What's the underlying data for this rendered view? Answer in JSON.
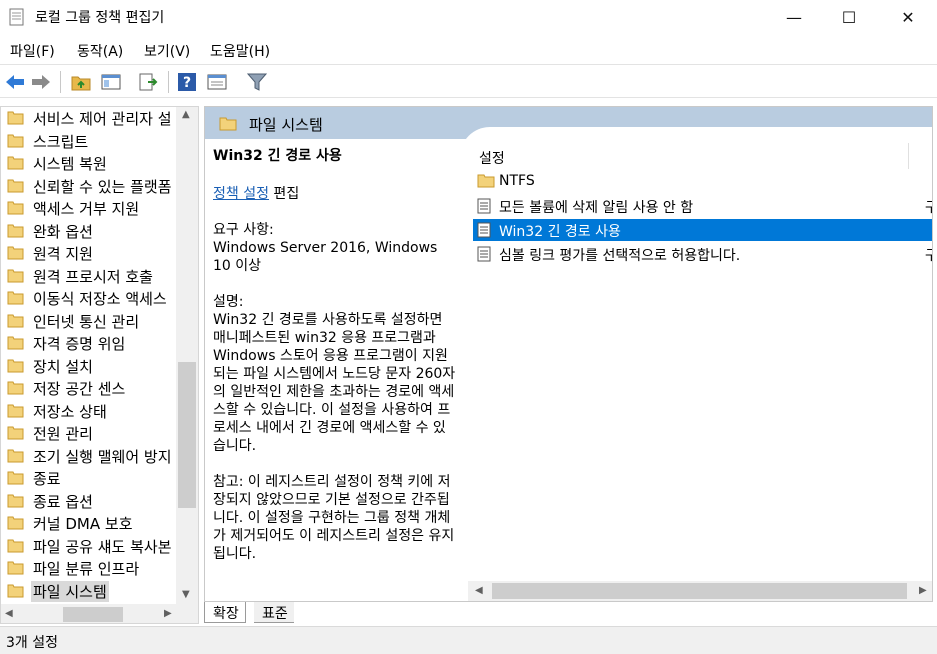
{
  "window": {
    "title": "로컬 그룹 정책 편집기",
    "minimize_glyph": "—",
    "maximize_glyph": "☐",
    "close_glyph": "✕"
  },
  "menu": [
    "파일(F)",
    "동작(A)",
    "보기(V)",
    "도움말(H)"
  ],
  "toolbar_icons": [
    "back-icon",
    "forward-icon",
    "up-folder-icon",
    "show-hide-tree-icon",
    "export-list-icon",
    "help-icon",
    "properties-icon",
    "filter-icon"
  ],
  "tree": {
    "items": [
      "서비스 제어 관리자 설",
      "스크립트",
      "시스템 복원",
      "신뢰할 수 있는 플랫폼",
      "액세스 거부 지원",
      "완화 옵션",
      "원격 지원",
      "원격 프로시저 호출",
      "이동식 저장소 액세스",
      "인터넷 통신 관리",
      "자격 증명 위임",
      "장치 설치",
      "저장 공간 센스",
      "저장소 상태",
      "전원 관리",
      "조기 실행 맬웨어 방지",
      "종료",
      "종료 옵션",
      "커널 DMA 보호",
      "파일 공유 섀도 복사본",
      "파일 분류 인프라",
      "파일 시스템"
    ],
    "selected_index": 21
  },
  "panel": {
    "header": "파일 시스템",
    "description": {
      "title": "Win32 긴 경로 사용",
      "edit_link": "정책 설정",
      "edit_suffix": " 편집",
      "requirements_label": "요구 사항:",
      "requirements": "Windows Server 2016, Windows 10 이상",
      "desc_label": "설명:",
      "desc_text": "Win32 긴 경로를 사용하도록 설정하면 매니페스트된 win32 응용 프로그램과 Windows 스토어 응용 프로그램이 지원되는 파일 시스템에서 노드당 문자 260자의 일반적인 제한을 초과하는 경로에 액세스할 수 있습니다. 이 설정을 사용하여 프로세스 내에서 긴 경로에 액세스할 수 있습니다.",
      "note_text": "참고: 이 레지스트리 설정이 정책 키에 저장되지 않았으므로 기본 설정으로 간주됩니다.  이 설정을 구현하는 그룹 정책 개체가 제거되어도 이 레지스트리 설정은 유지됩니다."
    },
    "list": {
      "column_header": "설정",
      "rows": [
        {
          "label": "NTFS",
          "icon": "folder-icon",
          "edge": ""
        },
        {
          "label": "모든 볼륨에 삭제 알림 사용 안 함",
          "icon": "policy-icon",
          "edge": "구"
        },
        {
          "label": "Win32 긴 경로 사용",
          "icon": "policy-icon",
          "edge": ""
        },
        {
          "label": "심볼 링크 평가를 선택적으로 허용합니다.",
          "icon": "policy-icon",
          "edge": "구"
        }
      ],
      "selected_index": 2
    },
    "tabs": [
      "확장",
      "표준"
    ]
  },
  "status": "3개 설정"
}
